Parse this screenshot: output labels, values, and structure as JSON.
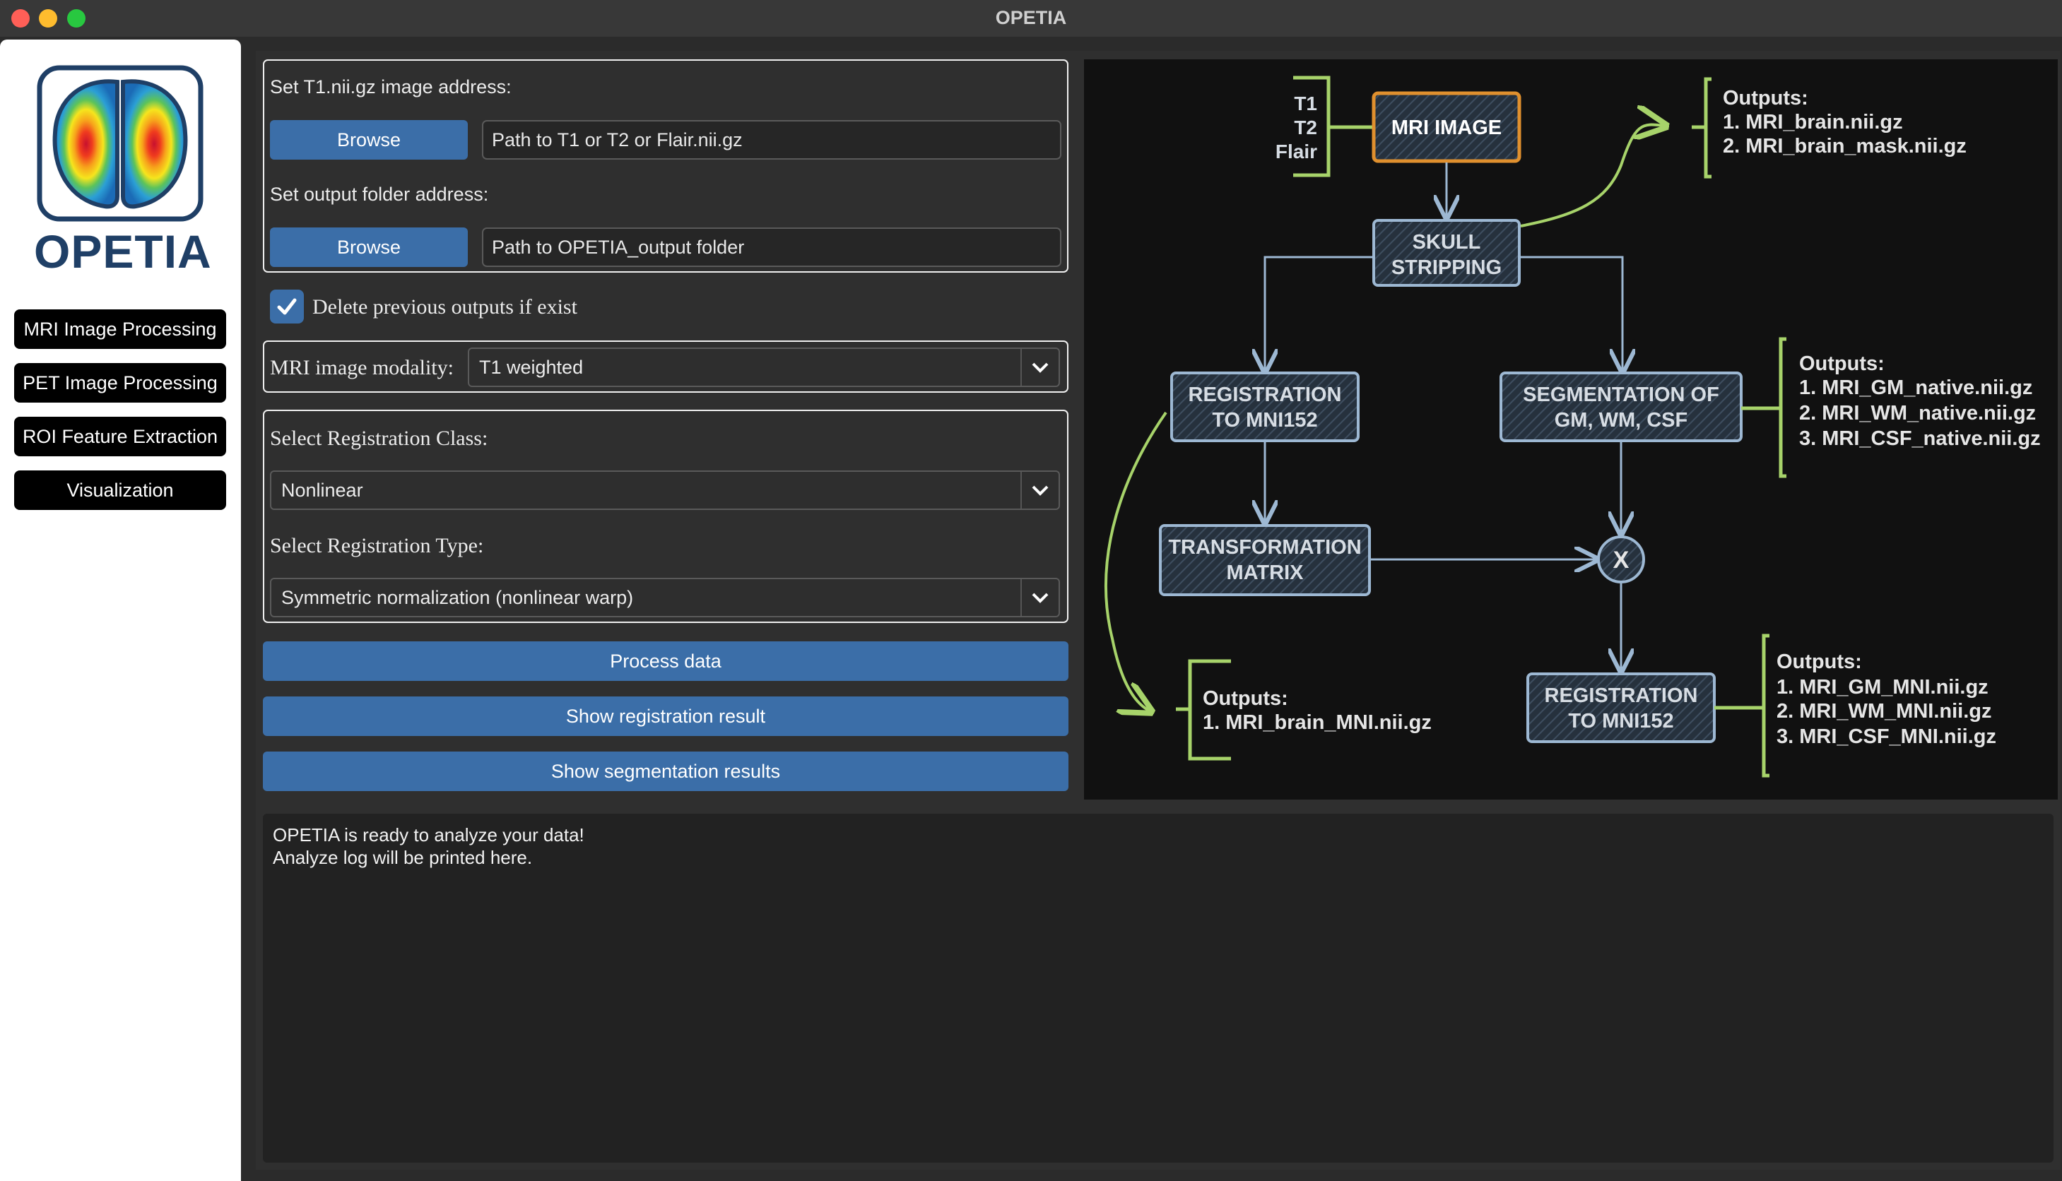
{
  "window": {
    "title": "OPETIA"
  },
  "sidebar": {
    "logo_text": "OPETIA",
    "items": [
      {
        "label": "MRI Image Processing"
      },
      {
        "label": "PET Image Processing"
      },
      {
        "label": "ROI Feature Extraction"
      },
      {
        "label": "Visualization"
      }
    ]
  },
  "input_group": {
    "image_label": "Set T1.nii.gz image address:",
    "browse_label": "Browse",
    "image_path": "Path to T1 or T2 or Flair.nii.gz",
    "output_label": "Set output folder address:",
    "output_path": "Path to OPETIA_output folder"
  },
  "delete_checkbox": {
    "label": "Delete previous outputs if exist",
    "checked": true
  },
  "modality": {
    "label": "MRI image modality:",
    "value": "T1 weighted"
  },
  "registration": {
    "class_label": "Select Registration Class:",
    "class_value": "Nonlinear",
    "type_label": "Select Registration Type:",
    "type_value": "Symmetric normalization (nonlinear warp)"
  },
  "actions": {
    "process": "Process data",
    "show_registration": "Show registration result",
    "show_segmentation": "Show segmentation results"
  },
  "diagram": {
    "inputs": [
      "T1",
      "T2",
      "Flair"
    ],
    "mri_image": "MRI IMAGE",
    "skull": [
      "SKULL",
      "STRIPPING"
    ],
    "reg_left": [
      "REGISTRATION",
      "TO MNI152"
    ],
    "seg": [
      "SEGMENTATION OF",
      "GM, WM, CSF"
    ],
    "transform": [
      "TRANSFORMATION",
      "MATRIX"
    ],
    "multiply": "X",
    "reg_right": [
      "REGISTRATION",
      "TO MNI152"
    ],
    "out_skull": [
      "Outputs:",
      "1. MRI_brain.nii.gz",
      "2. MRI_brain_mask.nii.gz"
    ],
    "out_seg": [
      "Outputs:",
      "1. MRI_GM_native.nii.gz",
      "2. MRI_WM_native.nii.gz",
      "3. MRI_CSF_native.nii.gz"
    ],
    "out_reg": [
      "Outputs:",
      "1. MRI_brain_MNI.nii.gz"
    ],
    "out_mni": [
      "Outputs:",
      "1. MRI_GM_MNI.nii.gz",
      "2. MRI_WM_MNI.nii.gz",
      "3. MRI_CSF_MNI.nii.gz"
    ]
  },
  "log": {
    "line1": "OPETIA is ready to analyze your data!",
    "line2": "Analyze log will be printed here."
  },
  "colors": {
    "accent_blue": "#3b6ea8",
    "sketch_green": "#a7d36a",
    "mri_box_orange": "#e0902e",
    "box_stroke": "#9db8d3"
  }
}
